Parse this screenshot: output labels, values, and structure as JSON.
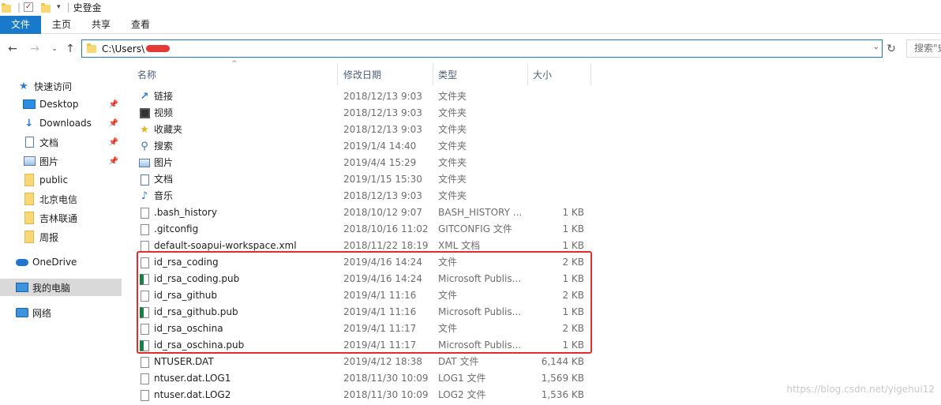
{
  "window": {
    "title": "史登金"
  },
  "ribbon": {
    "tabs": [
      "文件",
      "主页",
      "共享",
      "查看"
    ]
  },
  "address": {
    "path": "C:\\Users\\"
  },
  "search": {
    "placeholder": "搜索\"史"
  },
  "sidebar": {
    "items": [
      {
        "label": "快速访问",
        "icon": "star-icon"
      },
      {
        "label": "Desktop",
        "icon": "desktop-icon",
        "pinned": true
      },
      {
        "label": "Downloads",
        "icon": "downloads-icon",
        "pinned": true
      },
      {
        "label": "文档",
        "icon": "documents-icon",
        "pinned": true
      },
      {
        "label": "图片",
        "icon": "pictures-icon",
        "pinned": true
      },
      {
        "label": "public",
        "icon": "folder-icon"
      },
      {
        "label": "北京电信",
        "icon": "folder-icon"
      },
      {
        "label": "吉林联通",
        "icon": "folder-icon"
      },
      {
        "label": "周报",
        "icon": "folder-icon"
      },
      {
        "label": "OneDrive",
        "icon": "onedrive-icon"
      },
      {
        "label": "我的电脑",
        "icon": "computer-icon",
        "selected": true
      },
      {
        "label": "网络",
        "icon": "network-icon"
      }
    ]
  },
  "columns": {
    "name": "名称",
    "date": "修改日期",
    "type": "类型",
    "size": "大小"
  },
  "files": [
    {
      "name": "链接",
      "date": "2018/12/13 9:03",
      "type": "文件夹",
      "size": "",
      "icon": "link"
    },
    {
      "name": "视频",
      "date": "2018/12/13 9:03",
      "type": "文件夹",
      "size": "",
      "icon": "video"
    },
    {
      "name": "收藏夹",
      "date": "2018/12/13 9:03",
      "type": "文件夹",
      "size": "",
      "icon": "favorites"
    },
    {
      "name": "搜索",
      "date": "2019/1/4 14:40",
      "type": "文件夹",
      "size": "",
      "icon": "search"
    },
    {
      "name": "图片",
      "date": "2019/4/4 15:29",
      "type": "文件夹",
      "size": "",
      "icon": "pictures"
    },
    {
      "name": "文档",
      "date": "2019/1/15 15:30",
      "type": "文件夹",
      "size": "",
      "icon": "documents"
    },
    {
      "name": "音乐",
      "date": "2018/12/13 9:03",
      "type": "文件夹",
      "size": "",
      "icon": "music"
    },
    {
      "name": ".bash_history",
      "date": "2018/10/12 9:07",
      "type": "BASH_HISTORY ...",
      "size": "1 KB",
      "icon": "file"
    },
    {
      "name": ".gitconfig",
      "date": "2018/10/16 11:02",
      "type": "GITCONFIG 文件",
      "size": "1 KB",
      "icon": "file"
    },
    {
      "name": "default-soapui-workspace.xml",
      "date": "2018/11/22 18:19",
      "type": "XML 文档",
      "size": "1 KB",
      "icon": "file"
    },
    {
      "name": "id_rsa_coding",
      "date": "2019/4/16 14:24",
      "type": "文件",
      "size": "2 KB",
      "icon": "file"
    },
    {
      "name": "id_rsa_coding.pub",
      "date": "2019/4/16 14:24",
      "type": "Microsoft Publis...",
      "size": "1 KB",
      "icon": "pub"
    },
    {
      "name": "id_rsa_github",
      "date": "2019/4/1 11:16",
      "type": "文件",
      "size": "2 KB",
      "icon": "file"
    },
    {
      "name": "id_rsa_github.pub",
      "date": "2019/4/1 11:16",
      "type": "Microsoft Publis...",
      "size": "1 KB",
      "icon": "pub"
    },
    {
      "name": "id_rsa_oschina",
      "date": "2019/4/1 11:17",
      "type": "文件",
      "size": "2 KB",
      "icon": "file"
    },
    {
      "name": "id_rsa_oschina.pub",
      "date": "2019/4/1 11:17",
      "type": "Microsoft Publis...",
      "size": "1 KB",
      "icon": "pub"
    },
    {
      "name": "NTUSER.DAT",
      "date": "2019/4/12 18:38",
      "type": "DAT 文件",
      "size": "6,144 KB",
      "icon": "file"
    },
    {
      "name": "ntuser.dat.LOG1",
      "date": "2018/11/30 10:09",
      "type": "LOG1 文件",
      "size": "1,569 KB",
      "icon": "file"
    },
    {
      "name": "ntuser.dat.LOG2",
      "date": "2018/11/30 10:09",
      "type": "LOG2 文件",
      "size": "1,536 KB",
      "icon": "file"
    }
  ],
  "watermark": "https://blog.csdn.net/yigehui12"
}
